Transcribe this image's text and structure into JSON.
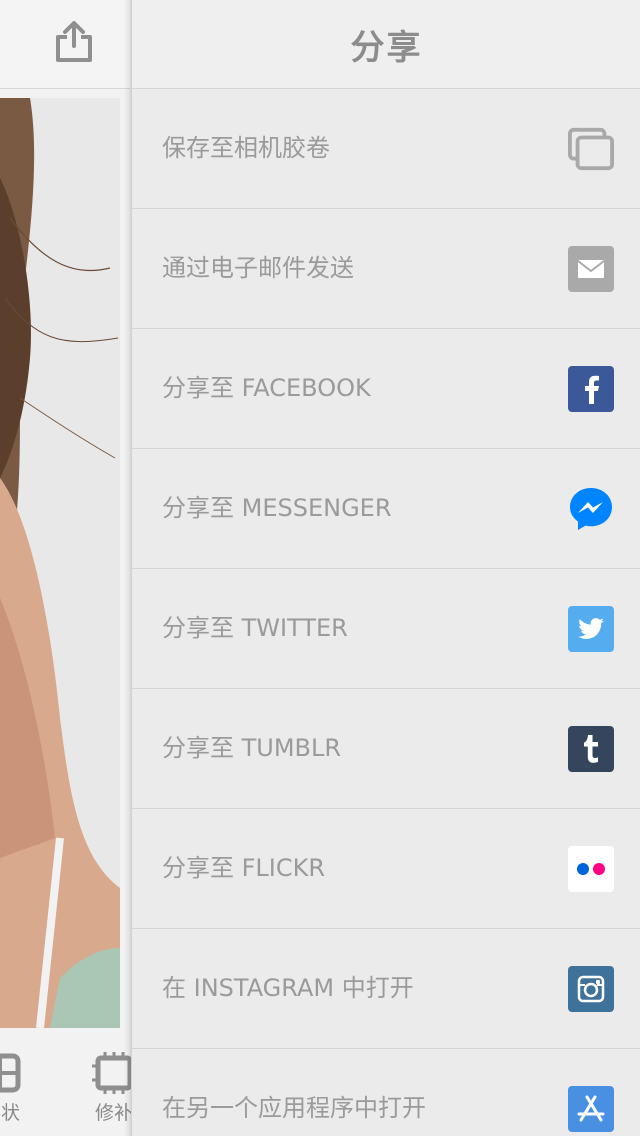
{
  "left_panel": {
    "share_button_icon": "share-upload-icon",
    "tools": [
      {
        "label": "形状",
        "icon": "shape-grid-icon"
      },
      {
        "label": "修补",
        "icon": "repair-chip-icon"
      }
    ]
  },
  "share_panel": {
    "title": "分享",
    "items": [
      {
        "label": "保存至相机胶卷",
        "icon": "camera-roll-icon",
        "color": "#a9a9a9"
      },
      {
        "label": "通过电子邮件发送",
        "icon": "mail-icon",
        "color": "#a9a9a9"
      },
      {
        "label": "分享至 FACEBOOK",
        "icon": "facebook-icon",
        "color": "#3b5998"
      },
      {
        "label": "分享至 MESSENGER",
        "icon": "messenger-icon",
        "color": "#0084ff"
      },
      {
        "label": "分享至 TWITTER",
        "icon": "twitter-icon",
        "color": "#55acee"
      },
      {
        "label": "分享至 TUMBLR",
        "icon": "tumblr-icon",
        "color": "#35465c"
      },
      {
        "label": "分享至 FLICKR",
        "icon": "flickr-icon",
        "color": "#ffffff"
      },
      {
        "label": "在 INSTAGRAM 中打开",
        "icon": "instagram-icon",
        "color": "#3f729b"
      },
      {
        "label": "在另一个应用程序中打开",
        "icon": "app-store-icon",
        "color": "#4a90e2"
      }
    ]
  }
}
